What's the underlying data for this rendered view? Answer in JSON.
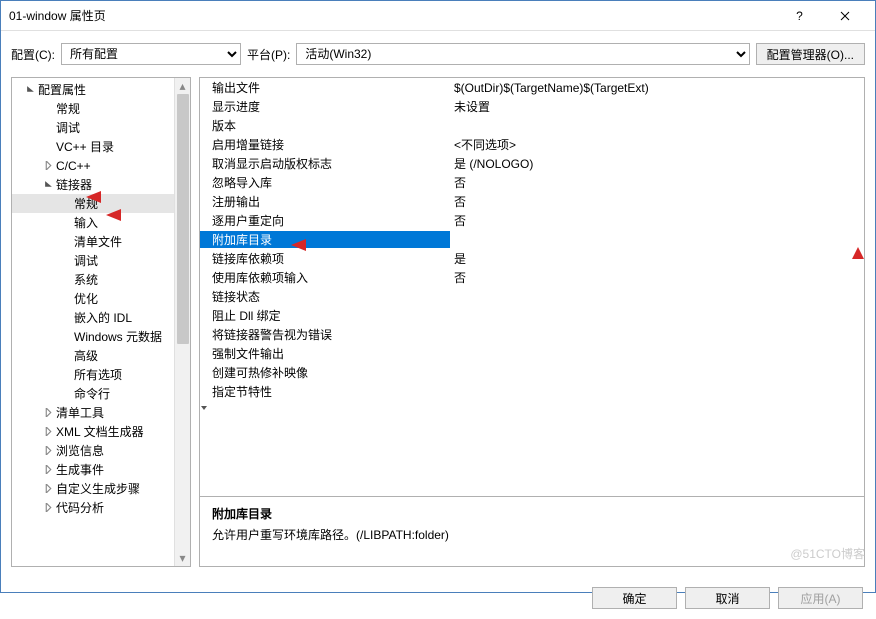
{
  "window": {
    "title": "01-window 属性页"
  },
  "config": {
    "label": "配置(C):",
    "value": "所有配置",
    "platform_label": "平台(P):",
    "platform_value": "活动(Win32)",
    "manager_btn": "配置管理器(O)..."
  },
  "tree": {
    "items": [
      {
        "l": 1,
        "exp": "open",
        "label": "配置属性"
      },
      {
        "l": 2,
        "exp": null,
        "label": "常规"
      },
      {
        "l": 2,
        "exp": null,
        "label": "调试"
      },
      {
        "l": 2,
        "exp": null,
        "label": "VC++ 目录"
      },
      {
        "l": 2,
        "exp": "closed",
        "label": "C/C++"
      },
      {
        "l": 2,
        "exp": "open",
        "label": "链接器"
      },
      {
        "l": 3,
        "exp": null,
        "label": "常规",
        "sel": true
      },
      {
        "l": 3,
        "exp": null,
        "label": "输入"
      },
      {
        "l": 3,
        "exp": null,
        "label": "清单文件"
      },
      {
        "l": 3,
        "exp": null,
        "label": "调试"
      },
      {
        "l": 3,
        "exp": null,
        "label": "系统"
      },
      {
        "l": 3,
        "exp": null,
        "label": "优化"
      },
      {
        "l": 3,
        "exp": null,
        "label": "嵌入的 IDL"
      },
      {
        "l": 3,
        "exp": null,
        "label": "Windows 元数据"
      },
      {
        "l": 3,
        "exp": null,
        "label": "高级"
      },
      {
        "l": 3,
        "exp": null,
        "label": "所有选项"
      },
      {
        "l": 3,
        "exp": null,
        "label": "命令行"
      },
      {
        "l": 2,
        "exp": "closed",
        "label": "清单工具"
      },
      {
        "l": 2,
        "exp": "closed",
        "label": "XML 文档生成器"
      },
      {
        "l": 2,
        "exp": "closed",
        "label": "浏览信息"
      },
      {
        "l": 2,
        "exp": "closed",
        "label": "生成事件"
      },
      {
        "l": 2,
        "exp": "closed",
        "label": "自定义生成步骤"
      },
      {
        "l": 2,
        "exp": "closed",
        "label": "代码分析"
      }
    ]
  },
  "grid": [
    {
      "key": "输出文件",
      "val": "$(OutDir)$(TargetName)$(TargetExt)"
    },
    {
      "key": "显示进度",
      "val": "未设置"
    },
    {
      "key": "版本",
      "val": ""
    },
    {
      "key": "启用增量链接",
      "val": "<不同选项>"
    },
    {
      "key": "取消显示启动版权标志",
      "val": "是 (/NOLOGO)"
    },
    {
      "key": "忽略导入库",
      "val": "否"
    },
    {
      "key": "注册输出",
      "val": "否"
    },
    {
      "key": "逐用户重定向",
      "val": "否"
    },
    {
      "key": "附加库目录",
      "val": "",
      "sel": true
    },
    {
      "key": "链接库依赖项",
      "val": "是"
    },
    {
      "key": "使用库依赖项输入",
      "val": "否"
    },
    {
      "key": "链接状态",
      "val": ""
    },
    {
      "key": "阻止 Dll 绑定",
      "val": ""
    },
    {
      "key": "将链接器警告视为错误",
      "val": ""
    },
    {
      "key": "强制文件输出",
      "val": ""
    },
    {
      "key": "创建可热修补映像",
      "val": ""
    },
    {
      "key": "指定节特性",
      "val": ""
    }
  ],
  "desc": {
    "title": "附加库目录",
    "body": "允许用户重写环境库路径。(/LIBPATH:folder)"
  },
  "buttons": {
    "ok": "确定",
    "cancel": "取消",
    "apply": "应用(A)"
  },
  "watermark": "@51CTO博客"
}
